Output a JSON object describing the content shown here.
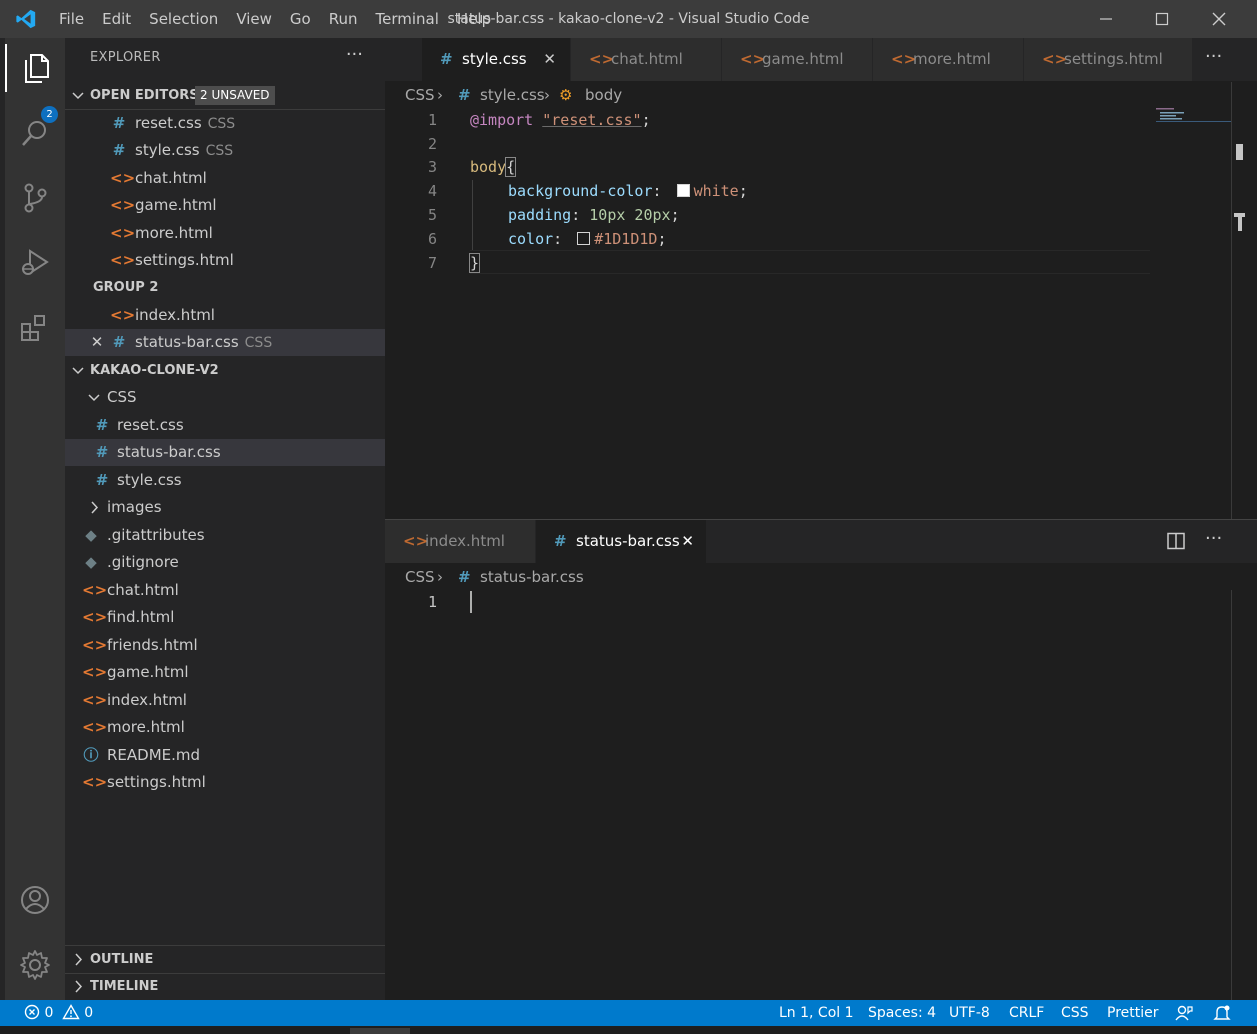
{
  "window": {
    "title": "status-bar.css - kakao-clone-v2 - Visual Studio Code",
    "menu": [
      "File",
      "Edit",
      "Selection",
      "View",
      "Go",
      "Run",
      "Terminal",
      "Help"
    ]
  },
  "activity_bar": {
    "explorer_badge": "2"
  },
  "sidebar": {
    "header": "EXPLORER",
    "more": "···",
    "open_editors": {
      "label": "OPEN EDITORS",
      "badge": "2 UNSAVED",
      "group1": [
        {
          "name": "reset.css",
          "desc": "CSS",
          "type": "css"
        },
        {
          "name": "style.css",
          "desc": "CSS",
          "type": "css"
        },
        {
          "name": "chat.html",
          "desc": "",
          "type": "html"
        },
        {
          "name": "game.html",
          "desc": "",
          "type": "html"
        },
        {
          "name": "more.html",
          "desc": "",
          "type": "html"
        },
        {
          "name": "settings.html",
          "desc": "",
          "type": "html"
        }
      ],
      "group2_label": "GROUP 2",
      "group2": [
        {
          "name": "index.html",
          "desc": "",
          "type": "html"
        },
        {
          "name": "status-bar.css",
          "desc": "CSS",
          "type": "css"
        }
      ]
    },
    "project": {
      "label": "KAKAO-CLONE-V2",
      "css_folder": "CSS",
      "css_files": [
        "reset.css",
        "status-bar.css",
        "style.css"
      ],
      "images_folder": "images",
      "files": [
        {
          "name": ".gitattributes",
          "type": "git"
        },
        {
          "name": ".gitignore",
          "type": "git"
        },
        {
          "name": "chat.html",
          "type": "html"
        },
        {
          "name": "find.html",
          "type": "html"
        },
        {
          "name": "friends.html",
          "type": "html"
        },
        {
          "name": "game.html",
          "type": "html"
        },
        {
          "name": "index.html",
          "type": "html"
        },
        {
          "name": "more.html",
          "type": "html"
        },
        {
          "name": "README.md",
          "type": "info"
        },
        {
          "name": "settings.html",
          "type": "html"
        }
      ]
    },
    "outline": "OUTLINE",
    "timeline": "TIMELINE"
  },
  "editor1": {
    "tabs": [
      "style.css",
      "chat.html",
      "game.html",
      "more.html",
      "settings.html"
    ],
    "more": "···",
    "breadcrumb": [
      "CSS",
      "style.css",
      "body"
    ],
    "lines": [
      "1",
      "2",
      "3",
      "4",
      "5",
      "6",
      "7"
    ],
    "code": {
      "import_kw": "@import",
      "import_str": "\"reset.css\"",
      "semi": ";",
      "selector": "body",
      "open_brace": "{",
      "prop1": "background-color",
      "val1": "white",
      "prop2": "padding",
      "val2": "10px 20px",
      "prop3": "color",
      "val3": "#1D1D1D",
      "close_brace": "}"
    }
  },
  "editor2": {
    "tabs": [
      "index.html",
      "status-bar.css"
    ],
    "more": "···",
    "breadcrumb": [
      "CSS",
      "status-bar.css"
    ],
    "lines": [
      "1"
    ]
  },
  "statusbar": {
    "errors": "0",
    "warnings": "0",
    "position": "Ln 1, Col 1",
    "spaces": "Spaces: 4",
    "encoding": "UTF-8",
    "eol": "CRLF",
    "language": "CSS",
    "formatter": "Prettier"
  },
  "colors": {
    "accent": "#007acc",
    "css_icon": "#519aba",
    "html_icon": "#e37933"
  }
}
